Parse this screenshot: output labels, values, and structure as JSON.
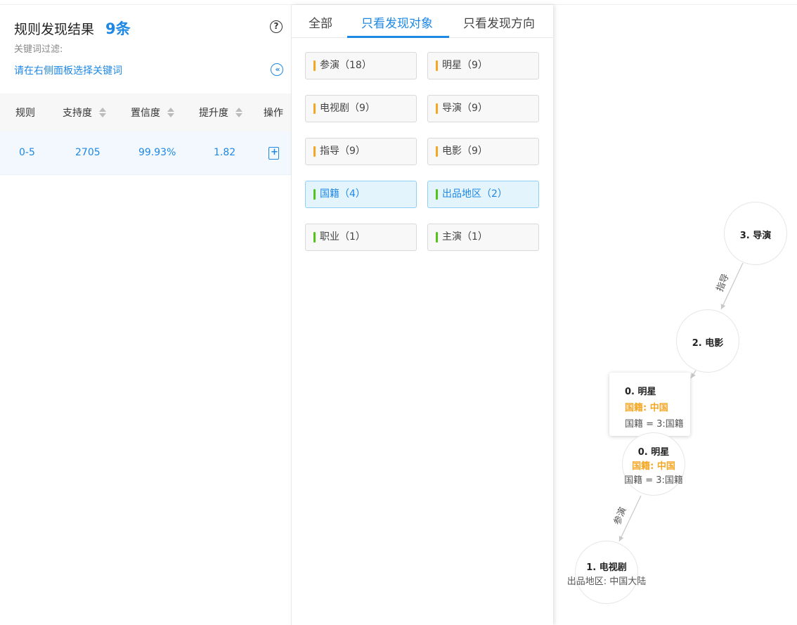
{
  "left_panel": {
    "title": "规则发现结果",
    "count": "9条",
    "help_icon": "?",
    "filter_label": "关键词过滤:",
    "filter_link": "请在右侧面板选择关键词",
    "collapse_icon": "«",
    "table": {
      "headers": [
        "规则",
        "支持度",
        "置信度",
        "提升度",
        "操作"
      ],
      "rows": [
        {
          "rule": "0-5",
          "support": "2705",
          "confidence": "99.93%",
          "lift": "1.82"
        }
      ]
    }
  },
  "tabs": [
    "全部",
    "只看发现对象",
    "只看发现方向"
  ],
  "active_tab": "只看发现对象",
  "tags": [
    {
      "label": "参演（18）",
      "color": "#f5a623",
      "selected": false
    },
    {
      "label": "明星（9）",
      "color": "#f5a623",
      "selected": false
    },
    {
      "label": "电视剧（9）",
      "color": "#f5a623",
      "selected": false
    },
    {
      "label": "导演（9）",
      "color": "#f5a623",
      "selected": false
    },
    {
      "label": "指导（9）",
      "color": "#f5a623",
      "selected": false
    },
    {
      "label": "电影（9）",
      "color": "#f5a623",
      "selected": false
    },
    {
      "label": "国籍（4）",
      "color": "#52c41a",
      "selected": true
    },
    {
      "label": "出品地区（2）",
      "color": "#52c41a",
      "selected": true
    },
    {
      "label": "职业（1）",
      "color": "#52c41a",
      "selected": false
    },
    {
      "label": "主演（1）",
      "color": "#52c41a",
      "selected": false
    }
  ],
  "graph": {
    "nodes": {
      "n3": {
        "title": "3. 导演"
      },
      "n2": {
        "title": "2. 电影"
      },
      "n0": {
        "title": "0. 明星",
        "attr": "国籍: 中国",
        "rule": "国籍 = 3:国籍"
      },
      "n1": {
        "title": "1. 电视剧",
        "attr": "出品地区: 中国大陆"
      }
    },
    "edges": {
      "e32": "指导",
      "e01": "参演"
    },
    "tooltip": {
      "title": "0. 明星",
      "attr": "国籍: 中国",
      "rule": "国籍 = 3:国籍"
    }
  },
  "colors": {
    "accent": "#1e88e5",
    "orange": "#f5a623",
    "green": "#52c41a"
  }
}
